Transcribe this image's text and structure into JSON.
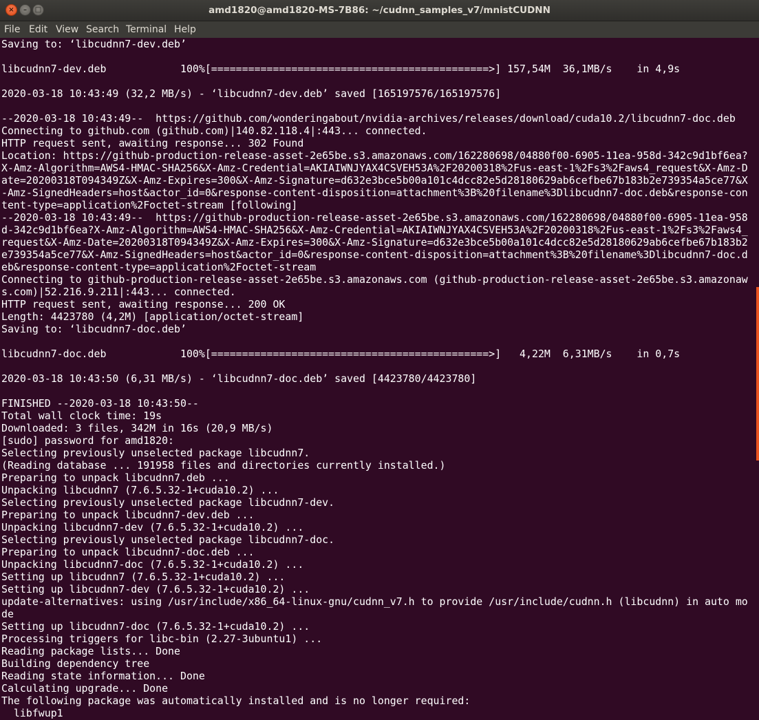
{
  "window": {
    "title": "amd1820@amd1820-MS-7B86: ~/cudnn_samples_v7/mnistCUDNN",
    "buttons": {
      "close_glyph": "×",
      "minimize_glyph": "–",
      "maximize_glyph": "□"
    }
  },
  "menubar": {
    "items": [
      {
        "label": "File"
      },
      {
        "label": "Edit"
      },
      {
        "label": "View"
      },
      {
        "label": "Search"
      },
      {
        "label": "Terminal"
      },
      {
        "label": "Help"
      }
    ]
  },
  "terminal": {
    "background": "#300a24",
    "foreground": "#ffffff",
    "scrollbar_color": "#e95420",
    "lines": [
      "Saving to: ‘libcudnn7-dev.deb’",
      "",
      "libcudnn7-dev.deb            100%[=============================================>] 157,54M  36,1MB/s    in 4,9s",
      "",
      "2020-03-18 10:43:49 (32,2 MB/s) - ‘libcudnn7-dev.deb’ saved [165197576/165197576]",
      "",
      "--2020-03-18 10:43:49--  https://github.com/wonderingabout/nvidia-archives/releases/download/cuda10.2/libcudnn7-doc.deb",
      "Connecting to github.com (github.com)|140.82.118.4|:443... connected.",
      "HTTP request sent, awaiting response... 302 Found",
      "Location: https://github-production-release-asset-2e65be.s3.amazonaws.com/162280698/04880f00-6905-11ea-958d-342c9d1bf6ea?",
      "X-Amz-Algorithm=AWS4-HMAC-SHA256&X-Amz-Credential=AKIAIWNJYAX4CSVEH53A%2F20200318%2Fus-east-1%2Fs3%2Faws4_request&X-Amz-D",
      "ate=20200318T094349Z&X-Amz-Expires=300&X-Amz-Signature=d632e3bce5b00a101c4dcc82e5d28180629ab6cefbe67b183b2e739354a5ce77&X",
      "-Amz-SignedHeaders=host&actor_id=0&response-content-disposition=attachment%3B%20filename%3Dlibcudnn7-doc.deb&response-con",
      "tent-type=application%2Foctet-stream [following]",
      "--2020-03-18 10:43:49--  https://github-production-release-asset-2e65be.s3.amazonaws.com/162280698/04880f00-6905-11ea-958",
      "d-342c9d1bf6ea?X-Amz-Algorithm=AWS4-HMAC-SHA256&X-Amz-Credential=AKIAIWNJYAX4CSVEH53A%2F20200318%2Fus-east-1%2Fs3%2Faws4_",
      "request&X-Amz-Date=20200318T094349Z&X-Amz-Expires=300&X-Amz-Signature=d632e3bce5b00a101c4dcc82e5d28180629ab6cefbe67b183b2",
      "e739354a5ce77&X-Amz-SignedHeaders=host&actor_id=0&response-content-disposition=attachment%3B%20filename%3Dlibcudnn7-doc.d",
      "eb&response-content-type=application%2Foctet-stream",
      "Connecting to github-production-release-asset-2e65be.s3.amazonaws.com (github-production-release-asset-2e65be.s3.amazonaw",
      "s.com)|52.216.9.211|:443... connected.",
      "HTTP request sent, awaiting response... 200 OK",
      "Length: 4423780 (4,2M) [application/octet-stream]",
      "Saving to: ‘libcudnn7-doc.deb’",
      "",
      "libcudnn7-doc.deb            100%[=============================================>]   4,22M  6,31MB/s    in 0,7s",
      "",
      "2020-03-18 10:43:50 (6,31 MB/s) - ‘libcudnn7-doc.deb’ saved [4423780/4423780]",
      "",
      "FINISHED --2020-03-18 10:43:50--",
      "Total wall clock time: 19s",
      "Downloaded: 3 files, 342M in 16s (20,9 MB/s)",
      "[sudo] password for amd1820:",
      "Selecting previously unselected package libcudnn7.",
      "(Reading database ... 191958 files and directories currently installed.)",
      "Preparing to unpack libcudnn7.deb ...",
      "Unpacking libcudnn7 (7.6.5.32-1+cuda10.2) ...",
      "Selecting previously unselected package libcudnn7-dev.",
      "Preparing to unpack libcudnn7-dev.deb ...",
      "Unpacking libcudnn7-dev (7.6.5.32-1+cuda10.2) ...",
      "Selecting previously unselected package libcudnn7-doc.",
      "Preparing to unpack libcudnn7-doc.deb ...",
      "Unpacking libcudnn7-doc (7.6.5.32-1+cuda10.2) ...",
      "Setting up libcudnn7 (7.6.5.32-1+cuda10.2) ...",
      "Setting up libcudnn7-dev (7.6.5.32-1+cuda10.2) ...",
      "update-alternatives: using /usr/include/x86_64-linux-gnu/cudnn_v7.h to provide /usr/include/cudnn.h (libcudnn) in auto mo",
      "de",
      "Setting up libcudnn7-doc (7.6.5.32-1+cuda10.2) ...",
      "Processing triggers for libc-bin (2.27-3ubuntu1) ...",
      "Reading package lists... Done",
      "Building dependency tree",
      "Reading state information... Done",
      "Calculating upgrade... Done",
      "The following package was automatically installed and is no longer required:",
      "  libfwup1"
    ]
  }
}
